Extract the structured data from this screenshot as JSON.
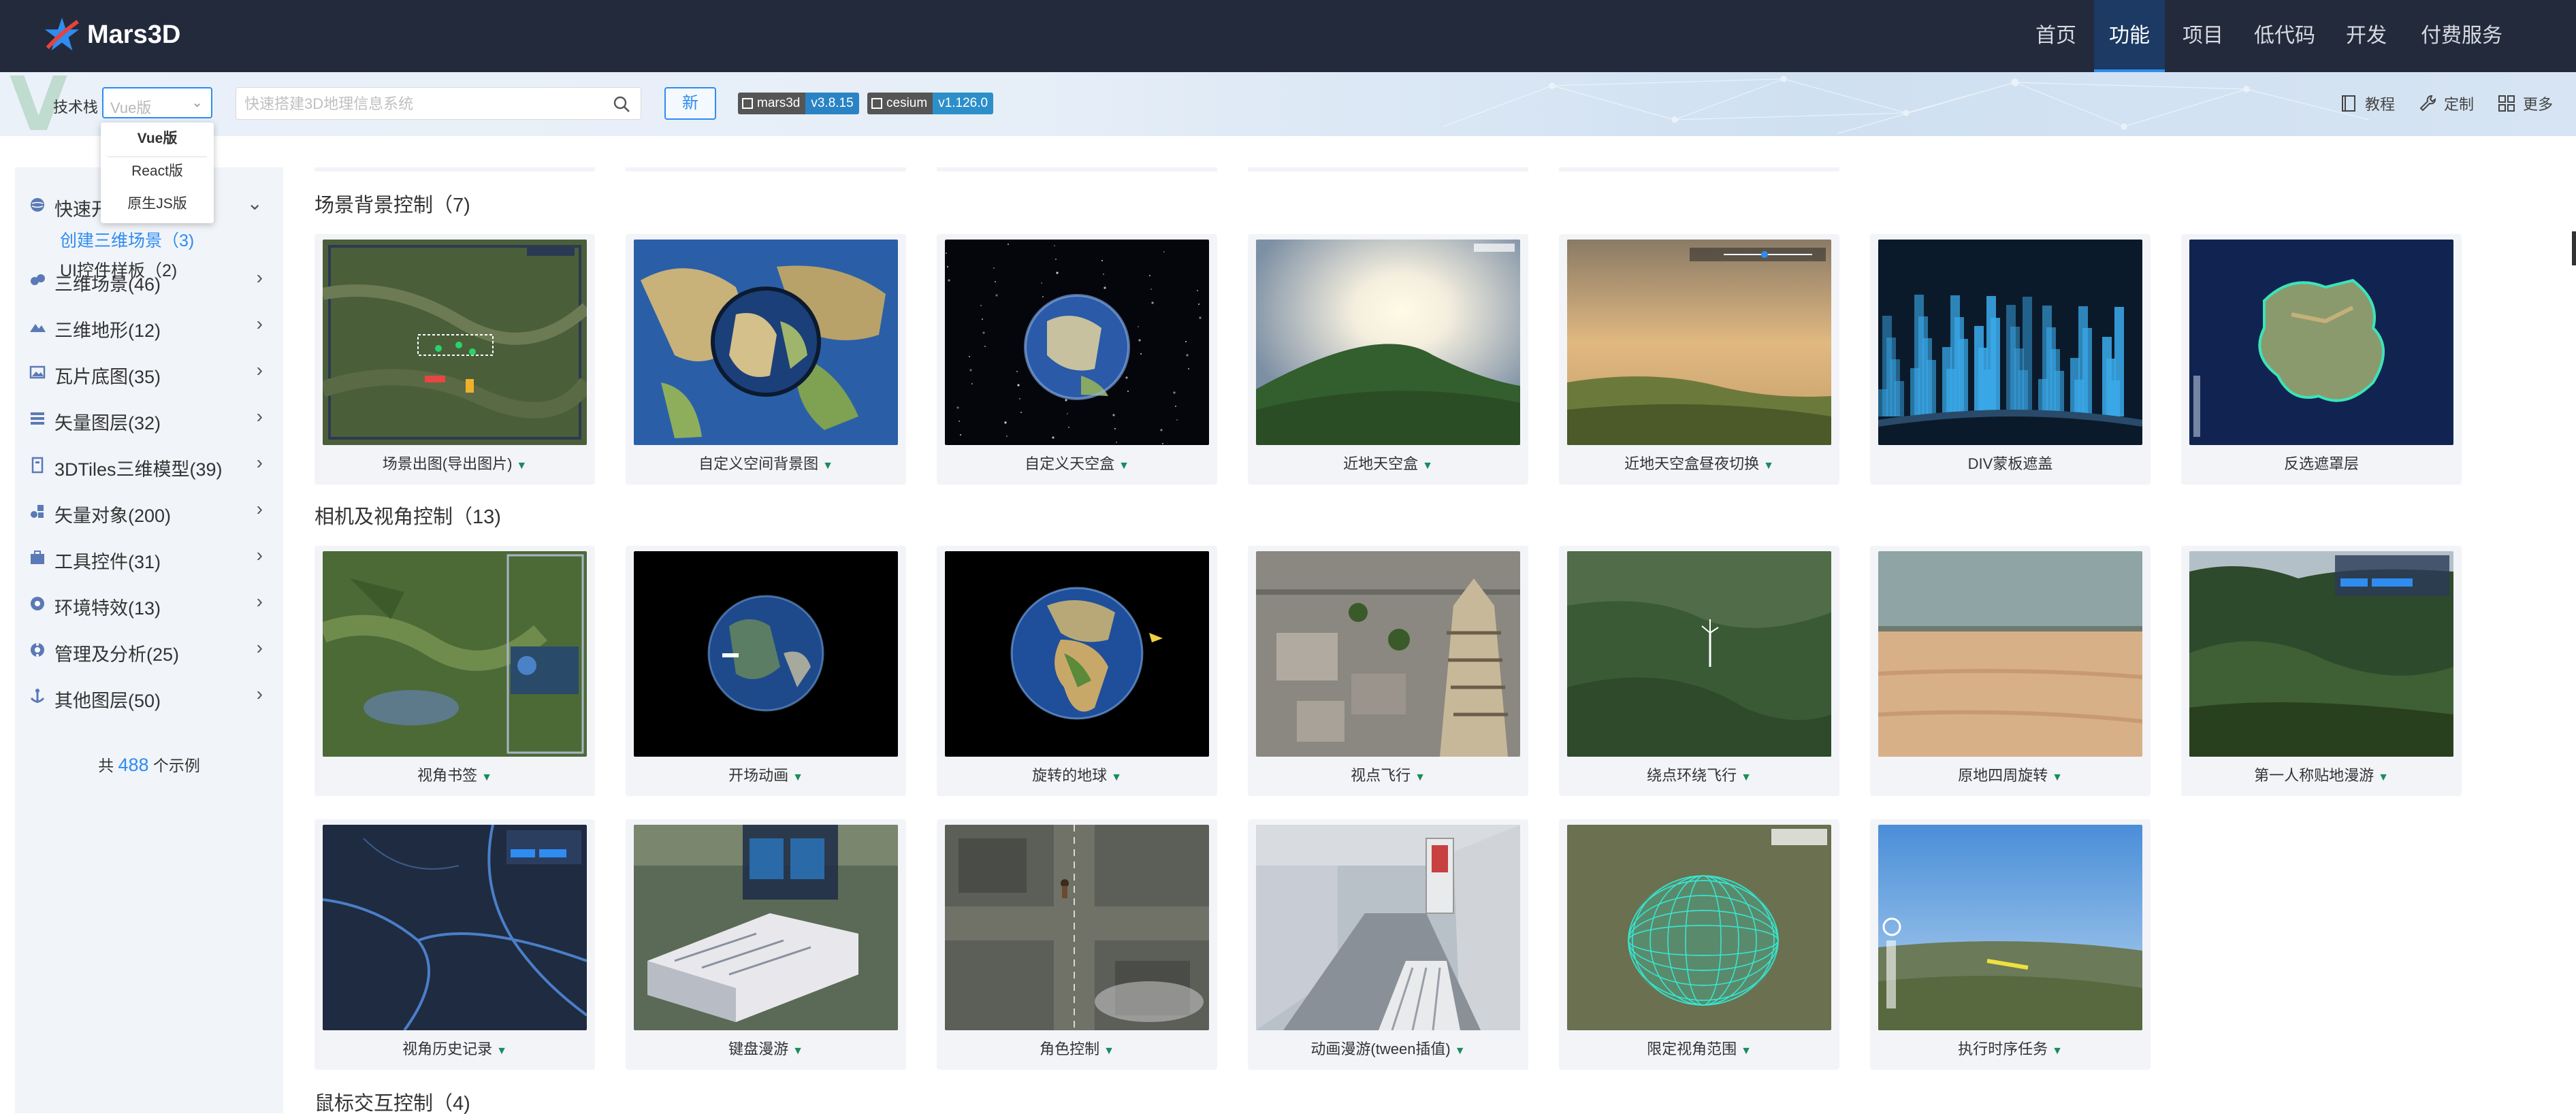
{
  "brand": {
    "name": "Mars3D"
  },
  "nav": {
    "items": [
      {
        "label": "首页"
      },
      {
        "label": "功能"
      },
      {
        "label": "项目"
      },
      {
        "label": "低代码"
      },
      {
        "label": "开发"
      },
      {
        "label": "付费服务"
      }
    ],
    "active": "功能"
  },
  "toolbar": {
    "tech_label": "技术栈",
    "tech_select_placeholder": "Vue版",
    "search_placeholder": "快速搭建3D地理信息系统",
    "new_label": "新",
    "badges": [
      {
        "key": "mars3d",
        "value": "v3.8.15"
      },
      {
        "key": "cesium",
        "value": "v1.126.0"
      }
    ],
    "right": [
      {
        "label": "教程",
        "icon": "book-icon"
      },
      {
        "label": "定制",
        "icon": "wrench-icon"
      },
      {
        "label": "更多",
        "icon": "grid-icon"
      }
    ]
  },
  "dropdown": {
    "options": [
      "Vue版",
      "React版",
      "原生JS版"
    ],
    "selected": "Vue版"
  },
  "sidebar": {
    "groups": [
      {
        "label": "快速开始",
        "icon": "globe-icon",
        "expanded": true,
        "children": [
          {
            "label": "创建三维场景（3)",
            "active": true
          },
          {
            "label": "UI控件样板（2)",
            "active": false
          }
        ]
      },
      {
        "label": "三维场景(46)",
        "icon": "layers-icon"
      },
      {
        "label": "三维地形(12)",
        "icon": "terrain-icon"
      },
      {
        "label": "瓦片底图(35)",
        "icon": "image-icon"
      },
      {
        "label": "矢量图层(32)",
        "icon": "list-icon"
      },
      {
        "label": "3DTiles三维模型(39)",
        "icon": "building-icon"
      },
      {
        "label": "矢量对象(200)",
        "icon": "shapes-icon"
      },
      {
        "label": "工具控件(31)",
        "icon": "toolbox-icon"
      },
      {
        "label": "环境特效(13)",
        "icon": "sun-icon"
      },
      {
        "label": "管理及分析(25)",
        "icon": "gear-icon"
      },
      {
        "label": "其他图层(50)",
        "icon": "anchor-icon"
      }
    ],
    "count_prefix": "共",
    "count": "488",
    "count_suffix": "个示例"
  },
  "sections": [
    {
      "title": "场景背景控制（7)",
      "cards": [
        {
          "label": "场景出图(导出图片)",
          "thumb": "map-screenshot",
          "tri": true
        },
        {
          "label": "自定义空间背景图",
          "thumb": "world-map-globe",
          "tri": true
        },
        {
          "label": "自定义天空盒",
          "thumb": "star-globe",
          "tri": true
        },
        {
          "label": "近地天空盒",
          "thumb": "sky-hill",
          "tri": true
        },
        {
          "label": "近地天空盒昼夜切换",
          "thumb": "sunset-hills",
          "tri": true
        },
        {
          "label": "DIV蒙板遮盖",
          "thumb": "blue-city",
          "tri": false
        },
        {
          "label": "反选遮罩层",
          "thumb": "mask-region",
          "tri": false
        }
      ]
    },
    {
      "title": "相机及视角控制（13)",
      "cards": [
        {
          "label": "视角书签",
          "thumb": "aerial-green",
          "tri": true
        },
        {
          "label": "开场动画",
          "thumb": "globe-black",
          "tri": true
        },
        {
          "label": "旋转的地球",
          "thumb": "globe-africa",
          "tri": true
        },
        {
          "label": "视点飞行",
          "thumb": "pagoda",
          "tri": true
        },
        {
          "label": "绕点环绕飞行",
          "thumb": "forest-valley",
          "tri": true
        },
        {
          "label": "原地四周旋转",
          "thumb": "desert",
          "tri": true
        },
        {
          "label": "第一人称贴地漫游",
          "thumb": "mountain-forest",
          "tri": true
        },
        {
          "label": "视角历史记录",
          "thumb": "dark-river",
          "tri": true
        },
        {
          "label": "键盘漫游",
          "thumb": "building-aerial",
          "tri": true
        },
        {
          "label": "角色控制",
          "thumb": "street-aerial",
          "tri": true
        },
        {
          "label": "动画漫游(tween插值)",
          "thumb": "indoor-escalator",
          "tri": true
        },
        {
          "label": "限定视角范围",
          "thumb": "wire-dome",
          "tri": true
        },
        {
          "label": "执行时序任务",
          "thumb": "sky-terrain",
          "tri": true
        }
      ]
    },
    {
      "title": "鼠标交互控制（4)",
      "cards": []
    }
  ],
  "colors": {
    "nav_bg": "#232a3b",
    "accent": "#2f8cf0",
    "sidebar_bg": "#f1f4f9",
    "card_bg": "#f2f4f8",
    "tri": "#1a8c5a"
  }
}
